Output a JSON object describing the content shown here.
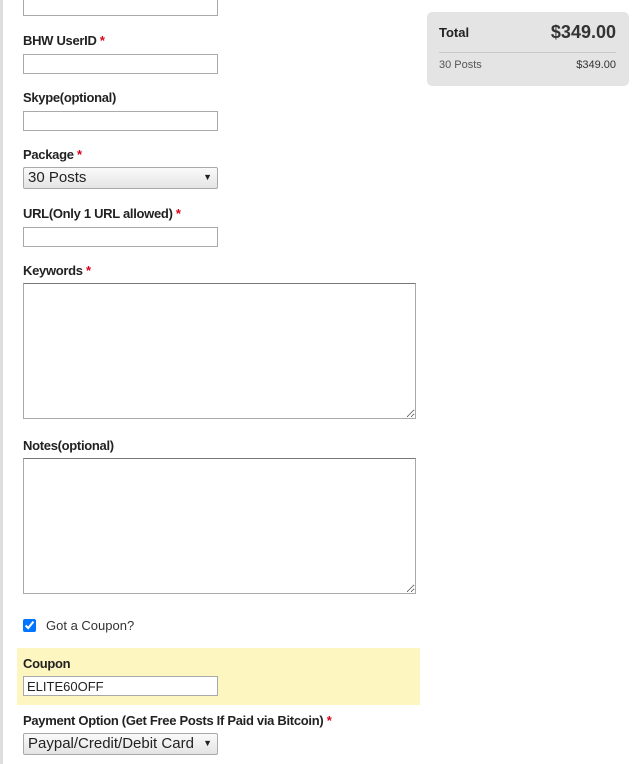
{
  "form": {
    "bhw_userid": {
      "label": "BHW UserID",
      "required_mark": "*",
      "value": ""
    },
    "skype": {
      "label": "Skype(optional)",
      "value": ""
    },
    "package": {
      "label": "Package",
      "required_mark": "*",
      "selected": "30 Posts"
    },
    "url": {
      "label": "URL(Only 1 URL allowed)",
      "required_mark": "*",
      "value": ""
    },
    "keywords": {
      "label": "Keywords",
      "required_mark": "*",
      "value": ""
    },
    "notes": {
      "label": "Notes(optional)",
      "value": ""
    },
    "coupon_toggle": {
      "label": "Got a Coupon?",
      "checked": true
    },
    "coupon": {
      "label": "Coupon",
      "value": "ELITE60OFF"
    },
    "payment": {
      "label": "Payment Option (Get Free Posts If Paid via Bitcoin)",
      "required_mark": "*",
      "selected": "Paypal/Credit/Debit Card"
    }
  },
  "summary": {
    "total_label": "Total",
    "total_value": "$349.00",
    "item_label": "30 Posts",
    "item_value": "$349.00"
  },
  "colors": {
    "required": "#d9001b",
    "coupon_highlight": "#fef6c1",
    "summary_bg": "#e4e4e4"
  },
  "icons": {
    "select_arrow": "triangle-down",
    "checkbox": "checkmark"
  }
}
